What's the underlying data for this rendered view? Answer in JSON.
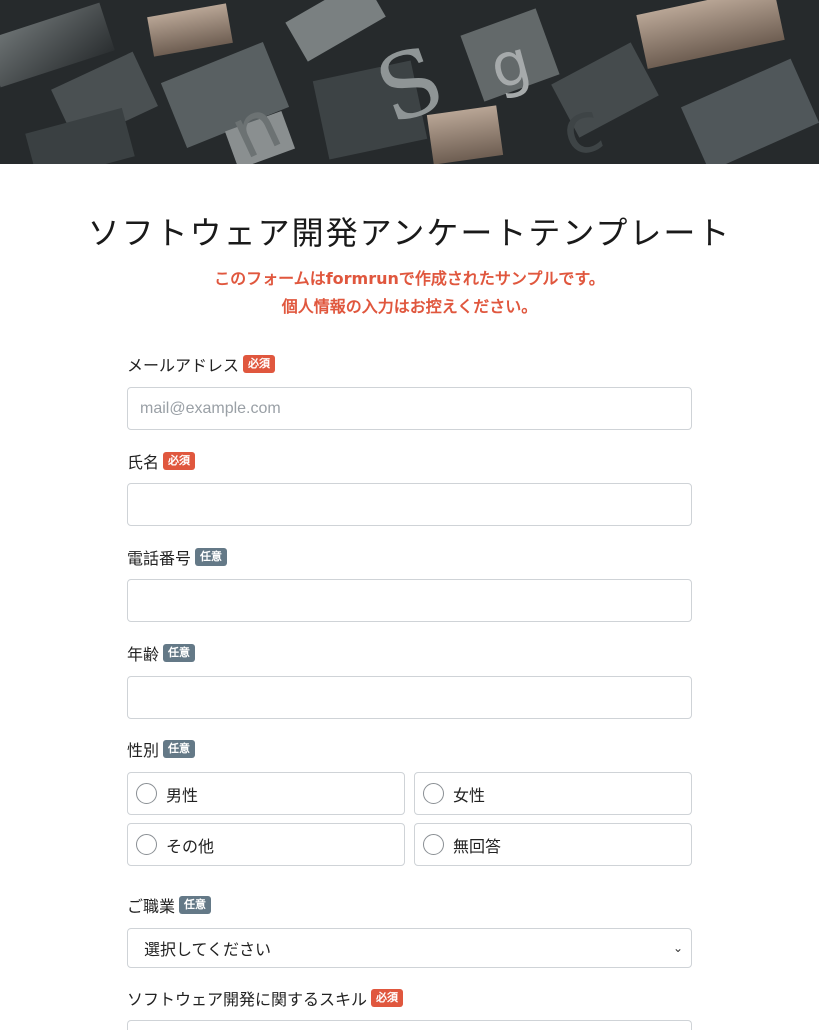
{
  "form": {
    "title": "ソフトウェア開発アンケートテンプレート",
    "notice_line1": "このフォームはformrunで作成されたサンプルです。",
    "notice_line2": "個人情報の入力はお控えください。"
  },
  "badges": {
    "required": "必須",
    "optional": "任意"
  },
  "fields": {
    "email": {
      "label": "メールアドレス",
      "placeholder": "mail@example.com",
      "value": ""
    },
    "name": {
      "label": "氏名",
      "value": ""
    },
    "phone": {
      "label": "電話番号",
      "value": ""
    },
    "age": {
      "label": "年齢",
      "value": ""
    },
    "gender": {
      "label": "性別",
      "options": [
        "男性",
        "女性",
        "その他",
        "無回答"
      ]
    },
    "occupation": {
      "label": "ご職業",
      "selected": "選択してください"
    },
    "skills": {
      "label": "ソフトウェア開発に関するスキル"
    }
  },
  "colors": {
    "accent_red": "#e0573e",
    "optional_badge": "#647987"
  },
  "icons": {
    "hero": "letterpress-type-photo",
    "select": "chevron-down-icon",
    "radio": "radio-circle-icon"
  }
}
